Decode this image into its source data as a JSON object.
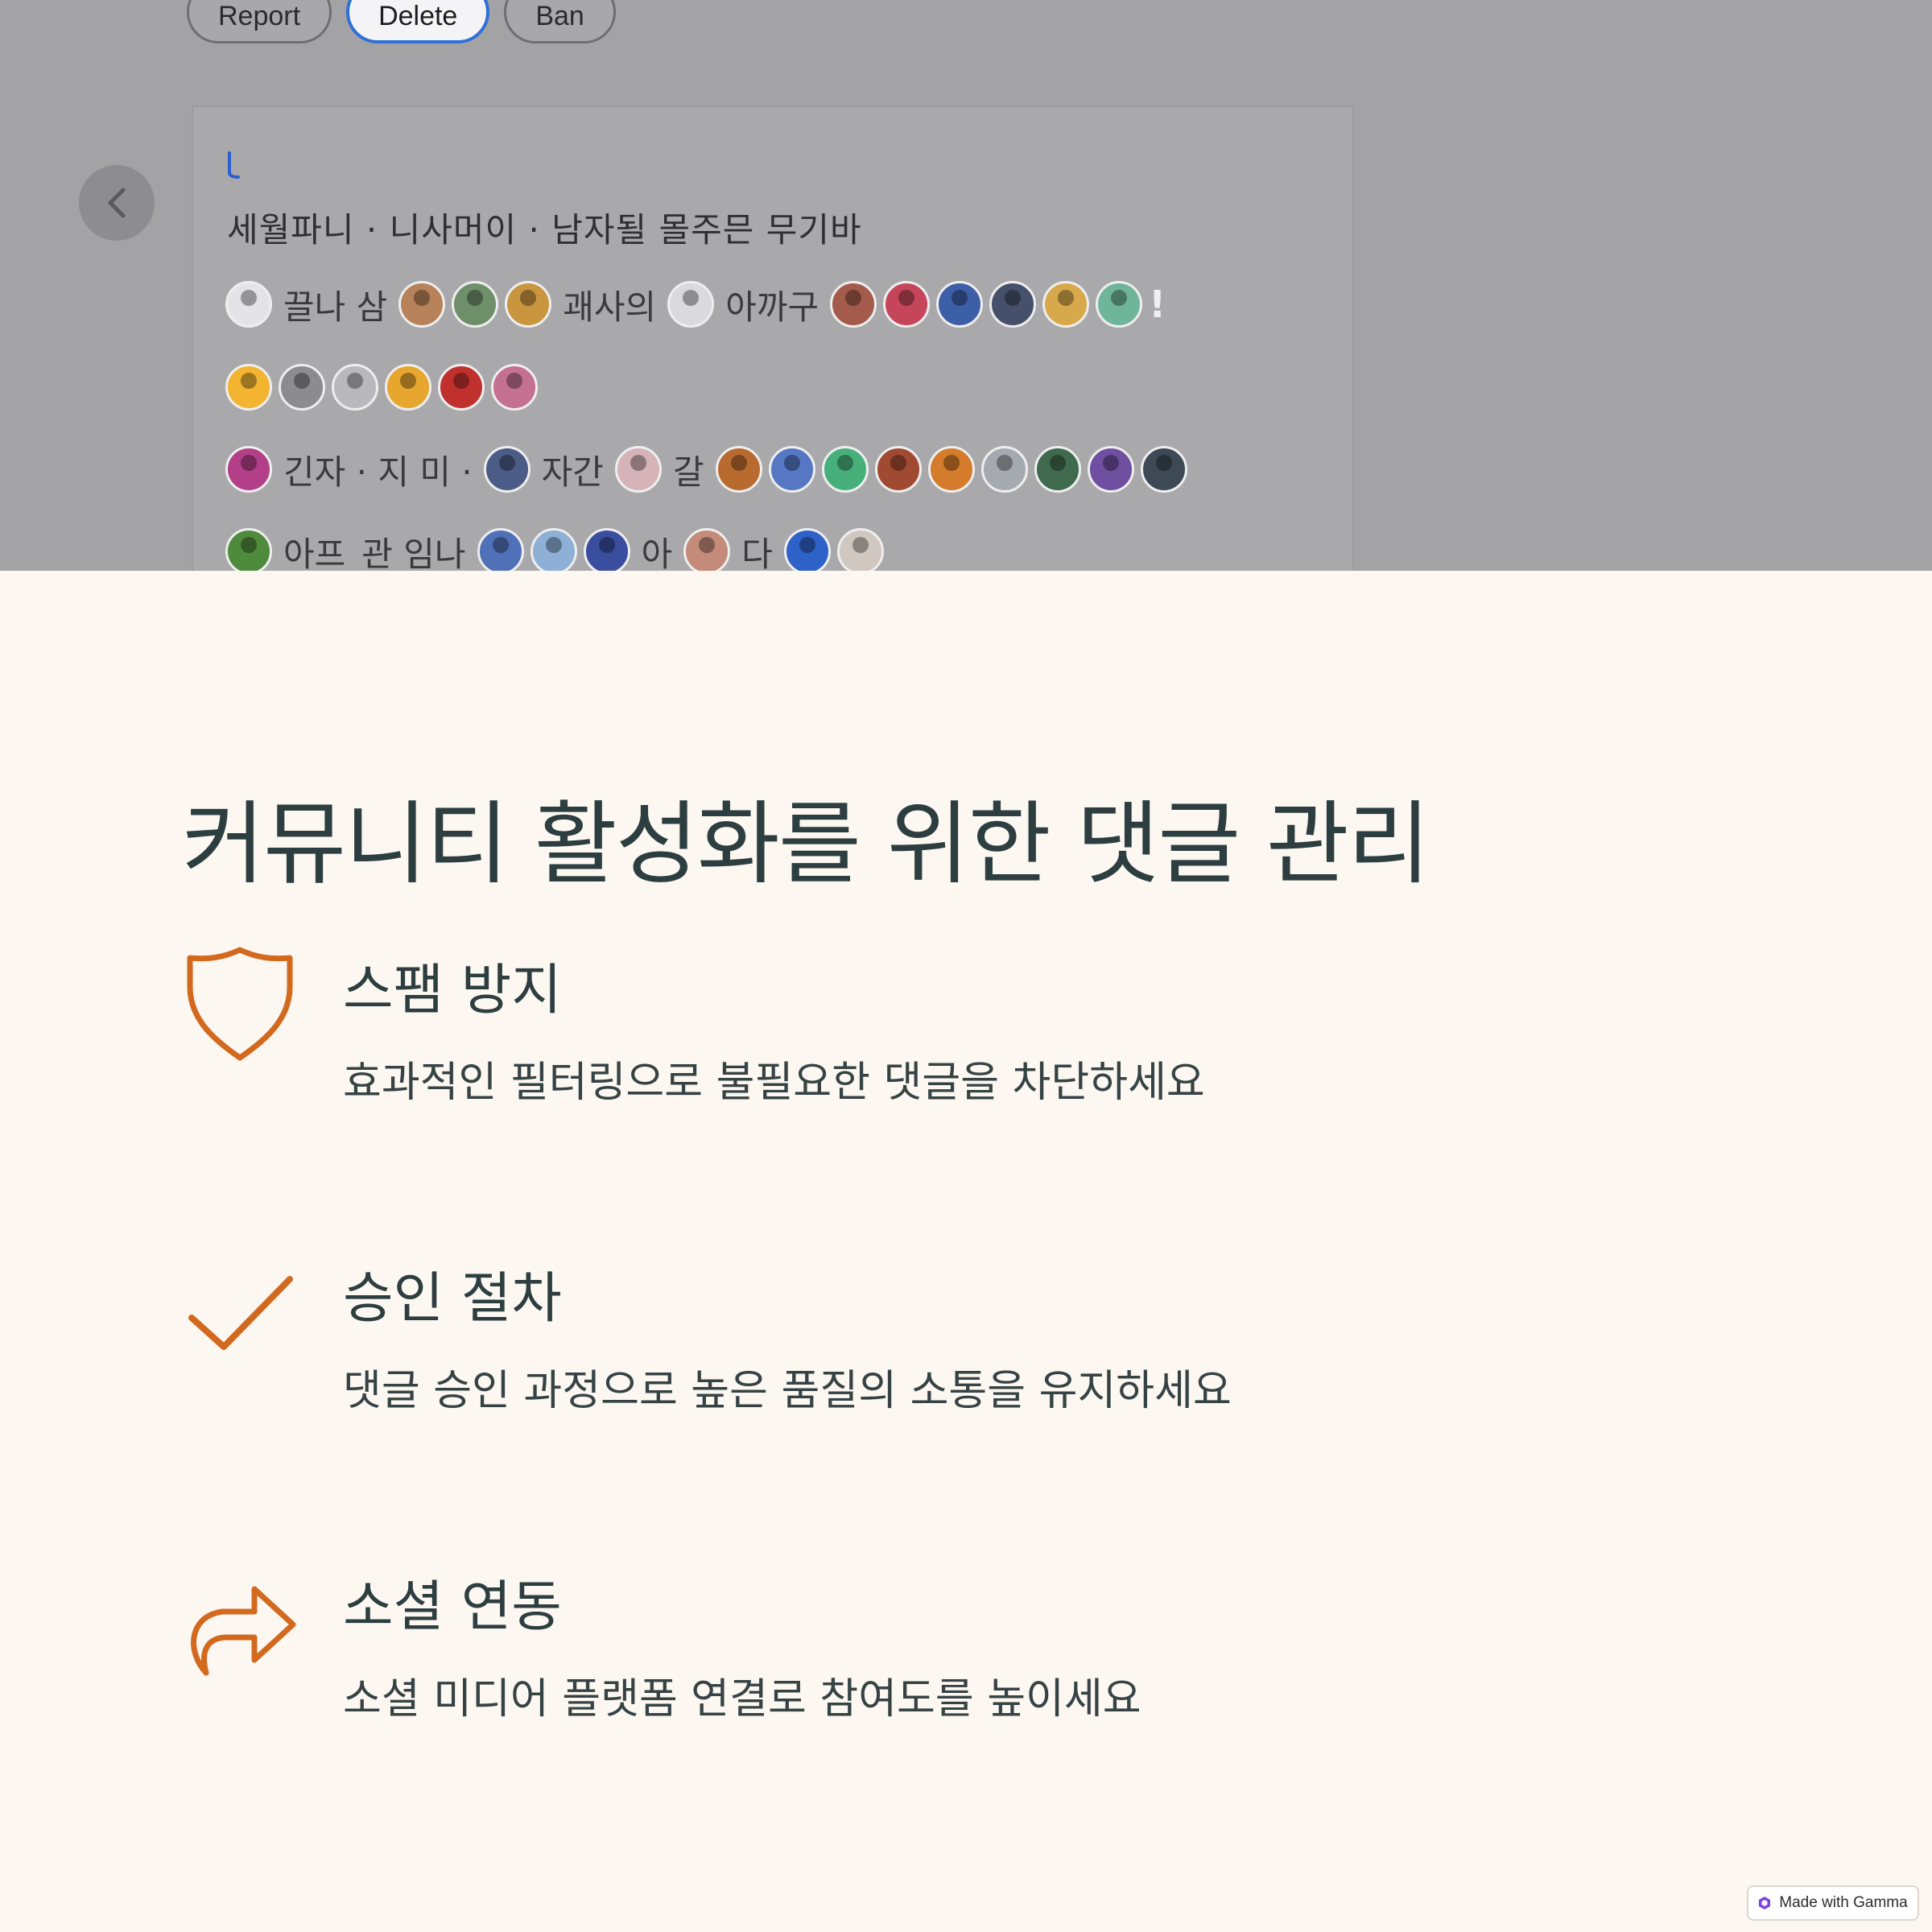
{
  "hero": {
    "buttons": [
      {
        "label": "Report",
        "active": false
      },
      {
        "label": "Delete",
        "active": true
      },
      {
        "label": "Ban",
        "active": false
      }
    ],
    "card_title": "세월파니 · 니사머이 · 남자될 몰주믄 무기바",
    "rows": [
      {
        "text": [
          "끌나 삼",
          "괘사의",
          "아까구"
        ]
      },
      {
        "text": []
      },
      {
        "text": [
          "긴자 · 지 미 ·",
          "자간",
          "갈"
        ]
      },
      {
        "text": [
          "아프",
          "관 임나",
          "아",
          "다"
        ]
      }
    ],
    "exclamation": "!"
  },
  "title": "커뮤니티 활성화를 위한 댓글 관리",
  "features": [
    {
      "icon": "shield-icon",
      "heading": "스팸 방지",
      "description": "효과적인 필터링으로 불필요한 댓글을 차단하세요"
    },
    {
      "icon": "checkmark-icon",
      "heading": "승인 절차",
      "description": "댓글 승인 과정으로 높은 품질의 소통을 유지하세요"
    },
    {
      "icon": "share-arrow-icon",
      "heading": "소셜 연동",
      "description": "소셜 미디어 플랫폼 연결로 참여도를 높이세요"
    }
  ],
  "accent_color": "#d2691e",
  "badge": {
    "label": "Made with Gamma"
  }
}
